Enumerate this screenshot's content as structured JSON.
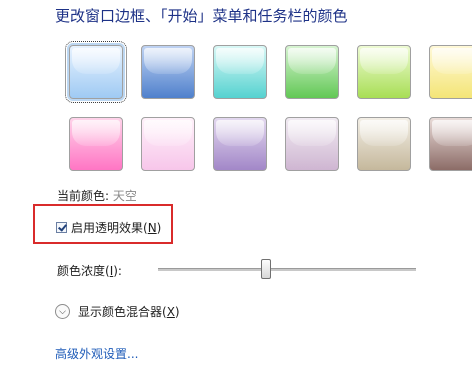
{
  "header": {
    "title": "更改窗口边框、「开始」菜单和任务栏的颜色"
  },
  "swatches": [
    {
      "name": "天空",
      "colors": [
        "#e8f3ff",
        "#9fcaf3"
      ],
      "selected": true
    },
    {
      "name": "",
      "colors": [
        "#bfd3f3",
        "#4f80cc"
      ]
    },
    {
      "name": "",
      "colors": [
        "#d9f8f6",
        "#55d2d0"
      ]
    },
    {
      "name": "",
      "colors": [
        "#d7f4d2",
        "#62c855"
      ]
    },
    {
      "name": "",
      "colors": [
        "#eefbd4",
        "#a8de55"
      ]
    },
    {
      "name": "",
      "colors": [
        "#fff9d8",
        "#f4e577"
      ]
    },
    {
      "name": "",
      "colors": [
        "#ffd4ea",
        "#ff75c4"
      ]
    },
    {
      "name": "",
      "colors": [
        "#fff1fa",
        "#f7c6ea"
      ]
    },
    {
      "name": "",
      "colors": [
        "#e3d8ef",
        "#a287c8"
      ]
    },
    {
      "name": "",
      "colors": [
        "#f1ebf2",
        "#cfb6d2"
      ]
    },
    {
      "name": "",
      "colors": [
        "#f3efe6",
        "#c5b89c"
      ]
    },
    {
      "name": "",
      "colors": [
        "#e9dbd8",
        "#8c6c67"
      ]
    }
  ],
  "current_color": {
    "label": "当前颜色:",
    "value": "天空"
  },
  "transparency": {
    "label_before": "启用透明效果(",
    "mnemonic": "N",
    "label_after": ")",
    "checked": true
  },
  "intensity": {
    "label_before": "颜色浓度(",
    "mnemonic": "I",
    "label_after": "):",
    "value": 0.42
  },
  "mixer": {
    "label_before": "显示颜色混合器(",
    "mnemonic": "X",
    "label_after": ")"
  },
  "advanced": {
    "label": "高级外观设置..."
  }
}
